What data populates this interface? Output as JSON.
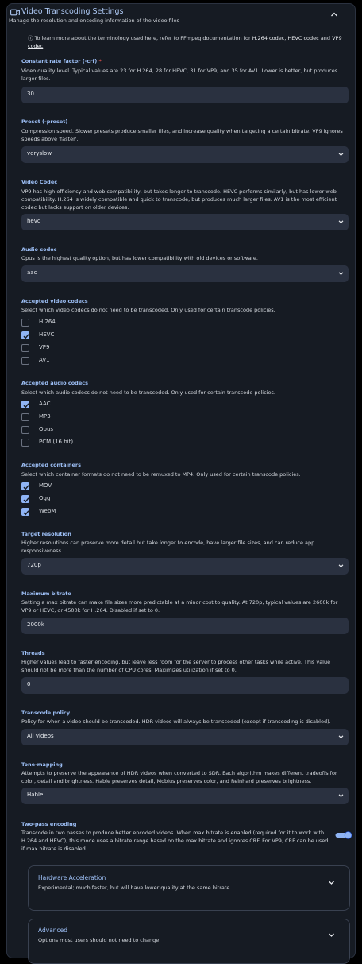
{
  "header": {
    "title": "Video Transcoding Settings",
    "subtitle": "Manage the resolution and encoding information of the video files"
  },
  "info": {
    "prefix": "To learn more about the terminology used here, refer to FFmpeg documentation for",
    "link_h264": "H.264 codec",
    "sep1": ",",
    "link_hevc": "HEVC codec",
    "and": "and",
    "link_vp9": "VP9 codec",
    "end": "."
  },
  "crf": {
    "label": "Constant rate factor (-crf)",
    "required_mark": "*",
    "description": "Video quality level. Typical values are 23 for H.264, 28 for HEVC, 31 for VP9, and 35 for AV1. Lower is better, but produces larger files.",
    "value": "30"
  },
  "preset": {
    "label": "Preset (-preset)",
    "description": "Compression speed. Slower presets produce smaller files, and increase quality when targeting a certain bitrate. VP9 ignores speeds above 'faster'.",
    "value": "veryslow"
  },
  "video_codec": {
    "label": "Video Codec",
    "description": "VP9 has high efficiency and web compatibility, but takes longer to transcode. HEVC performs similarly, but has lower web compatibility. H.264 is widely compatible and quick to transcode, but produces much larger files. AV1 is the most efficient codec but lacks support on older devices.",
    "value": "hevc"
  },
  "audio_codec": {
    "label": "Audio codec",
    "description": "Opus is the highest quality option, but has lower compatibility with old devices or software.",
    "value": "aac"
  },
  "accepted_video": {
    "label": "Accepted video codecs",
    "description": "Select which video codecs do not need to be transcoded. Only used for certain transcode policies.",
    "options": [
      {
        "label": "H.264",
        "checked": false
      },
      {
        "label": "HEVC",
        "checked": true
      },
      {
        "label": "VP9",
        "checked": false
      },
      {
        "label": "AV1",
        "checked": false
      }
    ]
  },
  "accepted_audio": {
    "label": "Accepted audio codecs",
    "description": "Select which audio codecs do not need to be transcoded. Only used for certain transcode policies.",
    "options": [
      {
        "label": "AAC",
        "checked": true
      },
      {
        "label": "MP3",
        "checked": false
      },
      {
        "label": "Opus",
        "checked": false
      },
      {
        "label": "PCM (16 bit)",
        "checked": false
      }
    ]
  },
  "accepted_containers": {
    "label": "Accepted containers",
    "description": "Select which container formats do not need to be remuxed to MP4. Only used for certain transcode policies.",
    "options": [
      {
        "label": "MOV",
        "checked": true
      },
      {
        "label": "Ogg",
        "checked": true
      },
      {
        "label": "WebM",
        "checked": true
      }
    ]
  },
  "target_resolution": {
    "label": "Target resolution",
    "description": "Higher resolutions can preserve more detail but take longer to encode, have larger file sizes, and can reduce app responsiveness.",
    "value": "720p"
  },
  "max_bitrate": {
    "label": "Maximum bitrate",
    "description": "Setting a max bitrate can make file sizes more predictable at a minor cost to quality. At 720p, typical values are 2600k for VP9 or HEVC, or 4500k for H.264. Disabled if set to 0.",
    "value": "2000k"
  },
  "threads": {
    "label": "Threads",
    "description": "Higher values lead to faster encoding, but leave less room for the server to process other tasks while active. This value should not be more than the number of CPU cores. Maximizes utilization if set to 0.",
    "value": "0"
  },
  "transcode_policy": {
    "label": "Transcode policy",
    "description": "Policy for when a video should be transcoded. HDR videos will always be transcoded (except if transcoding is disabled).",
    "value": "All videos"
  },
  "tone_mapping": {
    "label": "Tone-mapping",
    "description": "Attempts to preserve the appearance of HDR videos when converted to SDR. Each algorithm makes different tradeoffs for color, detail and brightness. Hable preserves detail, Mobius preserves color, and Reinhard preserves brightness.",
    "value": "Hable"
  },
  "two_pass": {
    "label": "Two-pass encoding",
    "description": "Transcode in two passes to produce better encoded videos. When max bitrate is enabled (required for it to work with H.264 and HEVC), this mode uses a bitrate range based on the max bitrate and ignores CRF. For VP9, CRF can be used if max bitrate is disabled.",
    "enabled": true
  },
  "hardware_acceleration": {
    "title": "Hardware Acceleration",
    "description": "Experimental; much faster, but will have lower quality at the same bitrate"
  },
  "advanced": {
    "title": "Advanced",
    "description": "Options most users should not need to change"
  },
  "colors": {
    "accent": "#8fb4f4",
    "panel": "#161b23",
    "field": "#2a3140",
    "required": "#ef5350"
  }
}
